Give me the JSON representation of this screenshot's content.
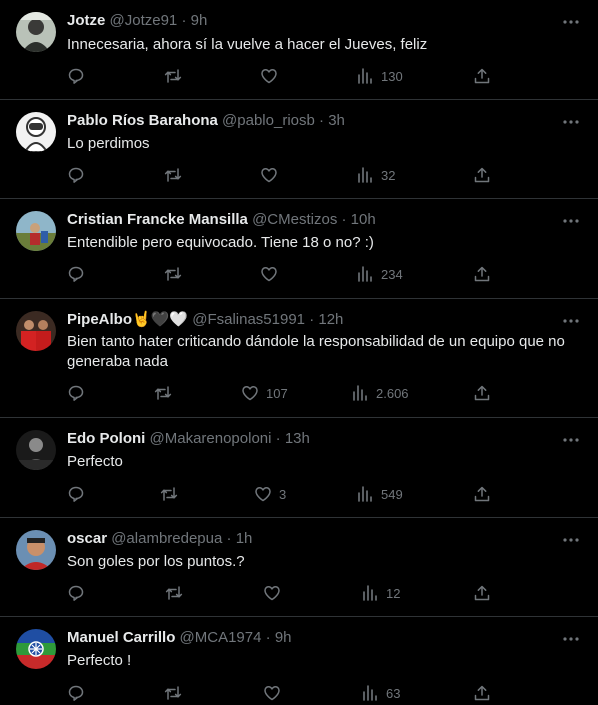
{
  "colors": {
    "background": "#000000",
    "text": "#e7e9ea",
    "secondary": "#71767b",
    "divider": "#2f3336"
  },
  "tweets": [
    {
      "name": "Jotze",
      "handle": "@Jotze91",
      "time": "9h",
      "text": "Innecesaria, ahora sí la vuelve a hacer el Jueves, feliz",
      "likes": "",
      "views": "130",
      "avatar": "portrait-avatar"
    },
    {
      "name": "Pablo Ríos Barahona",
      "handle": "@pablo_riosb",
      "time": "3h",
      "text": "Lo perdimos",
      "likes": "",
      "views": "32",
      "avatar": "astronaut-avatar"
    },
    {
      "name": "Cristian Francke Mansilla",
      "handle": "@CMestizos",
      "time": "10h",
      "text": "Entendible pero equivocado. Tiene 18 o no? :)",
      "likes": "",
      "views": "234",
      "avatar": "outdoor-photo-avatar"
    },
    {
      "name": "PipeAlbo",
      "name_emoji": "🤘🖤🤍",
      "handle": "@Fsalinas51991",
      "time": "12h",
      "text": "Bien tanto hater criticando dándole la responsabilidad de un equipo que no generaba nada",
      "likes": "107",
      "views": "2.606",
      "avatar": "red-jersey-avatar"
    },
    {
      "name": "Edo Poloni",
      "handle": "@Makarenopoloni",
      "time": "13h",
      "text": "Perfecto",
      "likes": "3",
      "views": "549",
      "avatar": "dark-photo-avatar"
    },
    {
      "name": "oscar",
      "handle": "@alambredepua",
      "time": "1h",
      "text": "Son goles por los puntos.?",
      "likes": "",
      "views": "12",
      "avatar": "man-photo-avatar"
    },
    {
      "name": "Manuel Carrillo",
      "handle": "@MCA1974",
      "time": "9h",
      "text": "Perfecto !",
      "likes": "",
      "views": "63",
      "avatar": "mapuche-flag-avatar"
    }
  ]
}
